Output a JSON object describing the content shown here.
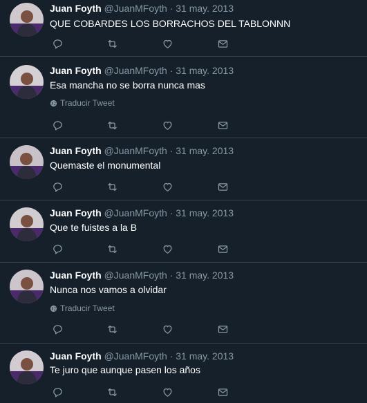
{
  "tweets": [
    {
      "name": "Juan Foyth",
      "handle": "@JuanMFoyth",
      "separator": "·",
      "date": "31 may. 2013",
      "text": "QUE COBARDES LOS BORRACHOS DEL TABLONNN",
      "translate": ""
    },
    {
      "name": "Juan Foyth",
      "handle": "@JuanMFoyth",
      "separator": "·",
      "date": "31 may. 2013",
      "text": "Esa mancha no se borra nunca mas",
      "translate": "Traducir Tweet"
    },
    {
      "name": "Juan Foyth",
      "handle": "@JuanMFoyth",
      "separator": "·",
      "date": "31 may. 2013",
      "text": "Quemaste el monumental",
      "translate": ""
    },
    {
      "name": "Juan Foyth",
      "handle": "@JuanMFoyth",
      "separator": "·",
      "date": "31 may. 2013",
      "text": "Que te fuistes a la B",
      "translate": ""
    },
    {
      "name": "Juan Foyth",
      "handle": "@JuanMFoyth",
      "separator": "·",
      "date": "31 may. 2013",
      "text": "Nunca nos vamos a olvidar",
      "translate": "Traducir Tweet"
    },
    {
      "name": "Juan Foyth",
      "handle": "@JuanMFoyth",
      "separator": "·",
      "date": "31 may. 2013",
      "text": "Te juro que aunque pasen los años",
      "translate": ""
    }
  ],
  "actions": [
    "reply-icon",
    "retweet-icon",
    "like-icon",
    "share-icon"
  ],
  "colors": {
    "background": "#15202b",
    "divider": "#38444d",
    "secondary": "#8899a6",
    "text": "#ffffff"
  }
}
